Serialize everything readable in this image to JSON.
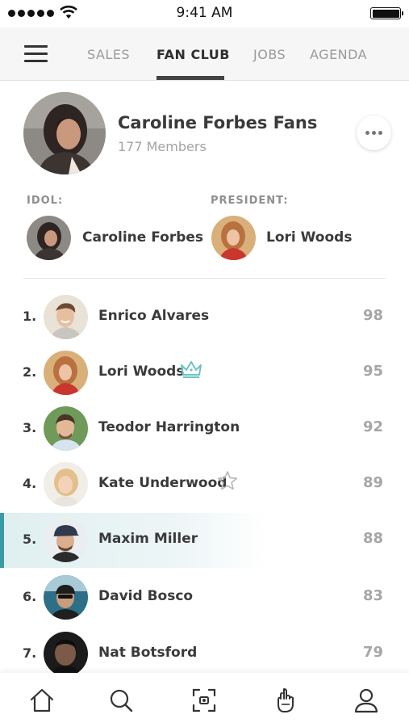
{
  "status_bar": {
    "time": "9:41 AM"
  },
  "nav": {
    "tabs": [
      {
        "label": "SALES"
      },
      {
        "label": "FAN CLUB"
      },
      {
        "label": "JOBS"
      },
      {
        "label": "AGENDA"
      }
    ],
    "active_tab": "FAN CLUB"
  },
  "club": {
    "name": "Caroline Forbes Fans",
    "members": "177 Members",
    "idol_label": "IDOL:",
    "idol_name": "Caroline Forbes",
    "president_label": "PRESIDENT:",
    "president_name": "Lori Woods"
  },
  "ranking": [
    {
      "rank": "1.",
      "name": "Enrico Alvares",
      "score": "98"
    },
    {
      "rank": "2.",
      "name": "Lori Woods",
      "score": "95",
      "badge": "crown-icon"
    },
    {
      "rank": "3.",
      "name": "Teodor Harrington",
      "score": "92"
    },
    {
      "rank": "4.",
      "name": "Kate Underwood",
      "score": "89",
      "badge": "star-icon"
    },
    {
      "rank": "5.",
      "name": "Maxim Miller",
      "score": "88",
      "highlighted": true
    },
    {
      "rank": "6.",
      "name": "David Bosco",
      "score": "83"
    },
    {
      "rank": "7.",
      "name": "Nat Botsford",
      "score": "79"
    }
  ],
  "bottom_nav": [
    "home-icon",
    "search-icon",
    "scan-icon",
    "fan-hand-icon",
    "profile-icon"
  ],
  "colors": {
    "accent": "#3a9ba4",
    "crown": "#6cc3c4",
    "score": "#a6a6a6"
  }
}
